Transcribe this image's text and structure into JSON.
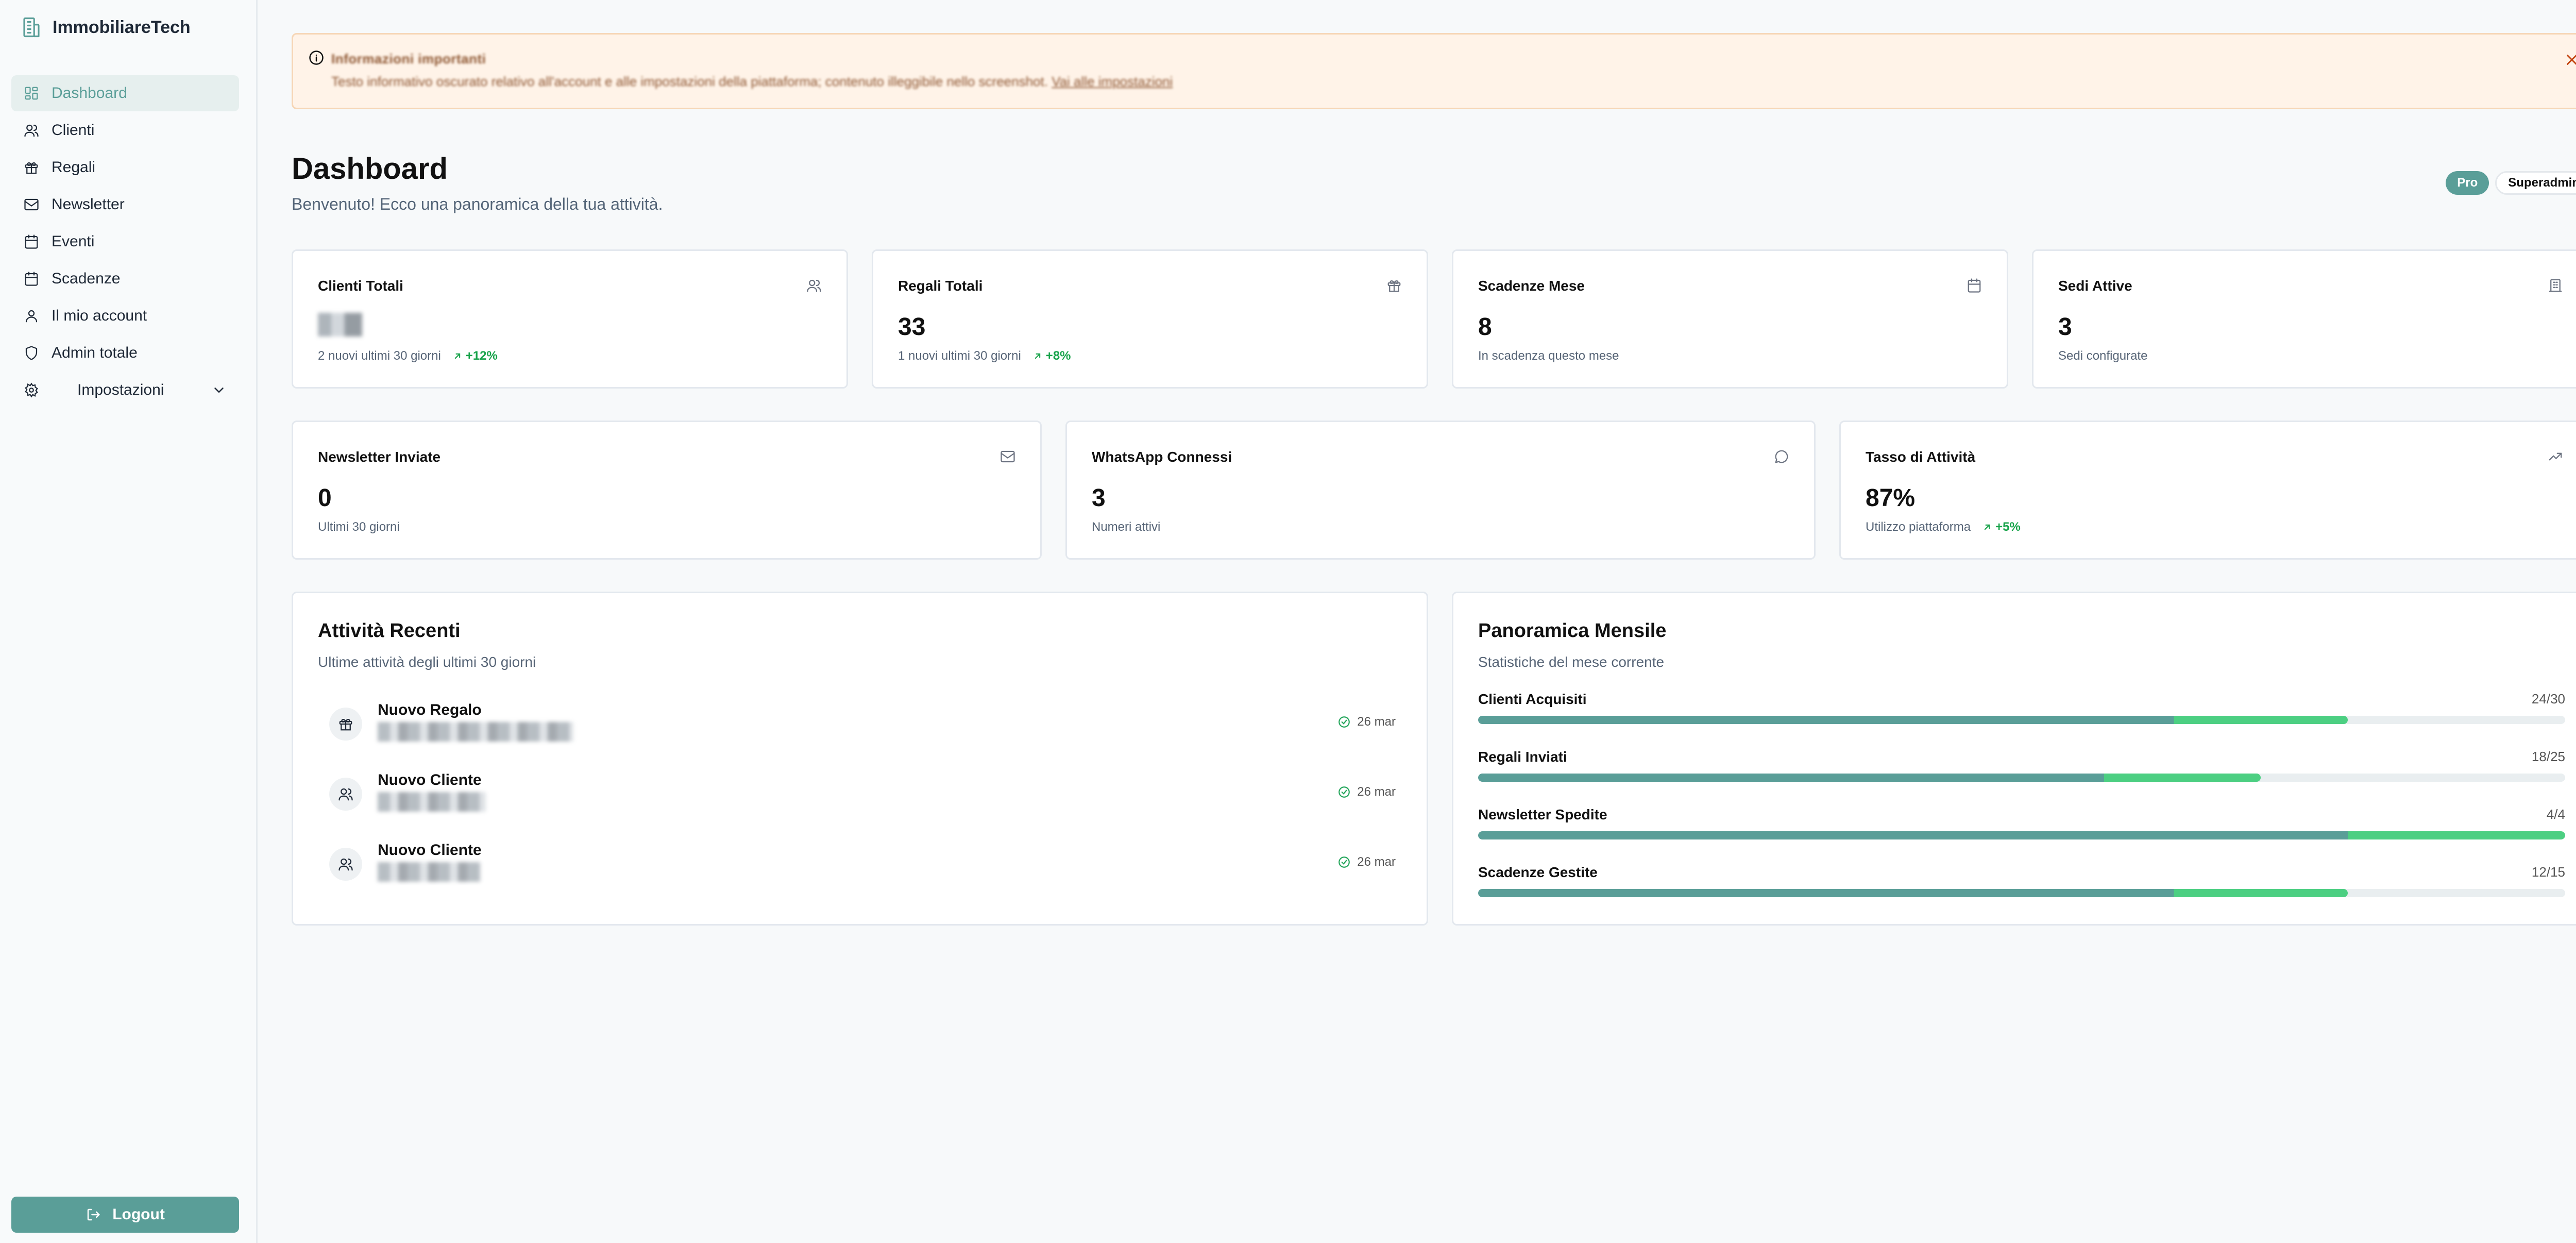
{
  "app": {
    "name": "ImmobiliareTech"
  },
  "sidebar": {
    "items": [
      {
        "label": "Dashboard",
        "icon": "dashboard-icon",
        "active": true
      },
      {
        "label": "Clienti",
        "icon": "users-icon"
      },
      {
        "label": "Regali",
        "icon": "gift-icon"
      },
      {
        "label": "Newsletter",
        "icon": "mail-icon"
      },
      {
        "label": "Eventi",
        "icon": "calendar-icon"
      },
      {
        "label": "Scadenze",
        "icon": "calendar-icon"
      },
      {
        "label": "Il mio account",
        "icon": "user-icon"
      },
      {
        "label": "Admin totale",
        "icon": "shield-icon"
      },
      {
        "label": "Impostazioni",
        "icon": "gear-icon",
        "expandable": true
      }
    ],
    "logout_label": "Logout"
  },
  "alert": {
    "title": "Informazioni importanti",
    "body": "Testo informativo oscurato relativo all'account e alle impostazioni della piattaforma; contenuto illeggibile nello screenshot.",
    "link": "Vai alle impostazioni"
  },
  "header": {
    "title": "Dashboard",
    "subtitle": "Benvenuto! Ecco una panoramica della tua attività.",
    "badges": [
      "Pro",
      "Superadmin"
    ]
  },
  "stats_row1": [
    {
      "title": "Clienti Totali",
      "value": "",
      "sub": "2 nuovi ultimi 30 giorni",
      "trend": "+12%",
      "icon": "users-icon"
    },
    {
      "title": "Regali Totali",
      "value": "33",
      "sub": "1 nuovi ultimi 30 giorni",
      "trend": "+8%",
      "icon": "gift-icon"
    },
    {
      "title": "Scadenze Mese",
      "value": "8",
      "sub": "In scadenza questo mese",
      "trend": "",
      "icon": "calendar-icon"
    },
    {
      "title": "Sedi Attive",
      "value": "3",
      "sub": "Sedi configurate",
      "trend": "",
      "icon": "building-icon"
    }
  ],
  "stats_row2": [
    {
      "title": "Newsletter Inviate",
      "value": "0",
      "sub": "Ultimi 30 giorni",
      "trend": "",
      "icon": "mail-icon"
    },
    {
      "title": "WhatsApp Connessi",
      "value": "3",
      "sub": "Numeri attivi",
      "trend": "",
      "icon": "chat-icon"
    },
    {
      "title": "Tasso di Attività",
      "value": "87%",
      "sub": "Utilizzo piattaforma",
      "trend": "+5%",
      "icon": "trending-up-icon"
    }
  ],
  "recent": {
    "title": "Attività Recenti",
    "subtitle": "Ultime attività degli ultimi 30 giorni",
    "items": [
      {
        "title": "Nuovo Regalo",
        "date": "26 mar",
        "icon": "gift-icon"
      },
      {
        "title": "Nuovo Cliente",
        "date": "26 mar",
        "icon": "users-icon"
      },
      {
        "title": "Nuovo Cliente",
        "date": "26 mar",
        "icon": "users-icon"
      }
    ]
  },
  "monthly": {
    "title": "Panoramica Mensile",
    "subtitle": "Statistiche del mese corrente",
    "items": [
      {
        "label": "Clienti Acquisiti",
        "value": "24/30",
        "progress": 0.8
      },
      {
        "label": "Regali Inviati",
        "value": "18/25",
        "progress": 0.72
      },
      {
        "label": "Newsletter Spedite",
        "value": "4/4",
        "progress": 1.0
      },
      {
        "label": "Scadenze Gestite",
        "value": "12/15",
        "progress": 0.8
      }
    ]
  },
  "colors": {
    "accent": "#5a9e98",
    "success": "#4ccf82",
    "warning_bg": "#fff3e8"
  }
}
